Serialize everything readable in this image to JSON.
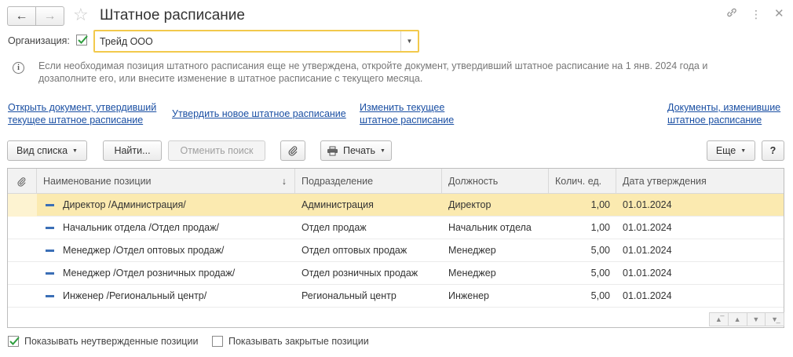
{
  "window": {
    "title": "Штатное расписание"
  },
  "org": {
    "label": "Организация:",
    "checked": true,
    "value": "Трейд ООО"
  },
  "info": {
    "text": "Если необходимая позиция штатного расписания еще не утверждена, откройте документ, утвердивший штатное расписание на 1 янв. 2024 года и дозаполните его, или внесите изменение в штатное расписание с текущего месяца."
  },
  "links": {
    "open_doc_line1": "Открыть документ, утвердивший",
    "open_doc_line2": "текущее штатное расписание",
    "approve_new": "Утвердить новое штатное расписание",
    "change_line1": "Изменить текущее",
    "change_line2": "штатное расписание",
    "docs_line1": "Документы, изменившие",
    "docs_line2": "штатное расписание"
  },
  "toolbar": {
    "view_list": "Вид списка",
    "find": "Найти...",
    "cancel_search": "Отменить поиск",
    "print": "Печать",
    "more": "Еще",
    "help": "?"
  },
  "table": {
    "columns": [
      "Наименование позиции",
      "Подразделение",
      "Должность",
      "Колич. ед.",
      "Дата утверждения"
    ],
    "rows": [
      {
        "name": "Директор /Администрация/",
        "dept": "Администрация",
        "position": "Директор",
        "qty": "1,00",
        "date": "01.01.2024"
      },
      {
        "name": "Начальник отдела /Отдел продаж/",
        "dept": "Отдел продаж",
        "position": "Начальник отдела",
        "qty": "1,00",
        "date": "01.01.2024"
      },
      {
        "name": "Менеджер /Отдел оптовых продаж/",
        "dept": "Отдел оптовых продаж",
        "position": "Менеджер",
        "qty": "5,00",
        "date": "01.01.2024"
      },
      {
        "name": "Менеджер /Отдел розничных продаж/",
        "dept": "Отдел розничных продаж",
        "position": "Менеджер",
        "qty": "5,00",
        "date": "01.01.2024"
      },
      {
        "name": "Инженер /Региональный центр/",
        "dept": "Региональный центр",
        "position": "Инженер",
        "qty": "5,00",
        "date": "01.01.2024"
      }
    ],
    "selected_row": 0,
    "sort_icon": "arrow-down-icon"
  },
  "bottom": {
    "show_unapproved": "Показывать неутвержденные позиции",
    "show_unapproved_checked": true,
    "show_closed": "Показывать закрытые позиции",
    "show_closed_checked": false
  },
  "colors": {
    "accent_border": "#f2c94c",
    "selected_row": "#fbeab0",
    "link": "#1a4fa3",
    "check": "#2e9e3e"
  }
}
